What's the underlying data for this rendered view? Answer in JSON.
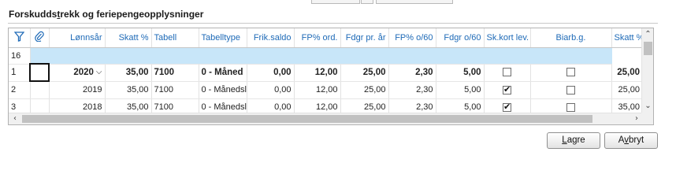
{
  "section": {
    "title_pre": "Forskudds",
    "title_mnemonic": "t",
    "title_post": "rekk og feriepengeopplysninger"
  },
  "grid": {
    "columns": [
      "Lønnsår",
      "Skatt %",
      "Tabell",
      "Tabelltype",
      "Frik.saldo",
      "FP% ord.",
      "Fdgr pr. år",
      "FP% o/60",
      "Fdgr o/60",
      "Sk.kort lev.",
      "Biarb.g.",
      "Skatt % biarb.give"
    ],
    "filter_row_label": "16",
    "rows": [
      {
        "num": "1",
        "year": "2020",
        "tax": "35,00",
        "table": "7100",
        "type": "0 - Måned",
        "free": "0,00",
        "fp_ord": "12,00",
        "fdgr_year": "25,00",
        "fp_o60": "2,30",
        "fdgr_o60": "5,00",
        "card": false,
        "side_emp": false,
        "side_tax": "25,00"
      },
      {
        "num": "2",
        "year": "2019",
        "tax": "35,00",
        "table": "7100",
        "type": "0 - Månedsl",
        "free": "0,00",
        "fp_ord": "12,00",
        "fdgr_year": "25,00",
        "fp_o60": "2,30",
        "fdgr_o60": "5,00",
        "card": true,
        "side_emp": false,
        "side_tax": "25,00"
      },
      {
        "num": "3",
        "year": "2018",
        "tax": "35,00",
        "table": "7100",
        "type": "0 - Månedsl",
        "free": "0,00",
        "fp_ord": "12,00",
        "fdgr_year": "25,00",
        "fp_o60": "2,30",
        "fdgr_o60": "5,00",
        "card": true,
        "side_emp": false,
        "side_tax": "35,00"
      }
    ]
  },
  "icons": {
    "filter": "filter-icon",
    "attachment": "paperclip-icon",
    "dropdown": "chevron-down-icon"
  },
  "buttons": {
    "save_mnemonic": "L",
    "save_rest": "agre",
    "cancel_pre": "A",
    "cancel_mnemonic": "v",
    "cancel_post": "bryt"
  },
  "colors": {
    "header_text": "#1e6ab7",
    "filter_row_bg": "#c8e6f9"
  }
}
